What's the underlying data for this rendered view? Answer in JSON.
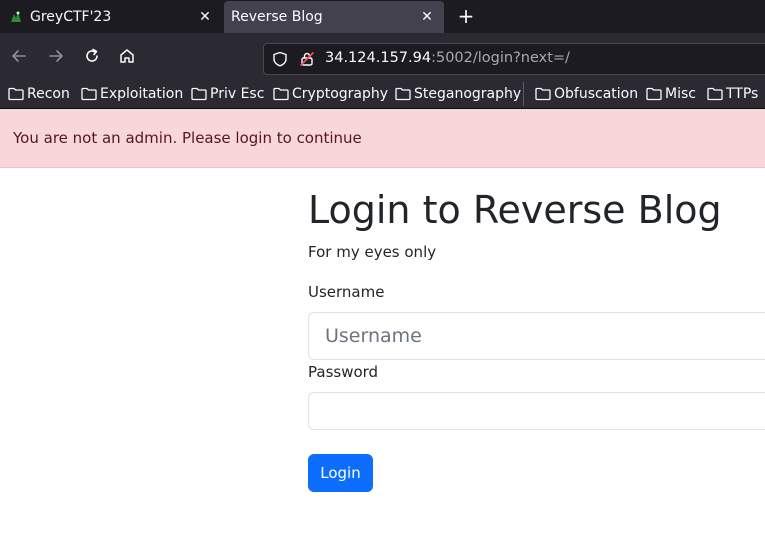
{
  "browser": {
    "tabs": [
      {
        "title": "GreyCTF'23",
        "active": false
      },
      {
        "title": "Reverse Blog",
        "active": true
      }
    ],
    "url": {
      "host": "34.124.157.94",
      "rest": ":5002/login?next=/"
    },
    "bookmarks": [
      "Recon",
      "Exploitation",
      "Priv Esc",
      "Cryptography",
      "Steganography",
      "Obfuscation",
      "Misc",
      "TTPs"
    ],
    "colors": {
      "tabbar": "#1c1b22",
      "toolbar": "#2b2a33",
      "active_tab": "#42414d"
    }
  },
  "alert": {
    "message": "You are not an admin. Please login to continue",
    "color": "#f8d7da"
  },
  "login": {
    "heading": "Login to Reverse Blog",
    "subheading": "For my eyes only",
    "username_label": "Username",
    "username_placeholder": "Username",
    "password_label": "Password",
    "password_value": "",
    "button": "Login",
    "button_color": "#0d6efd"
  }
}
